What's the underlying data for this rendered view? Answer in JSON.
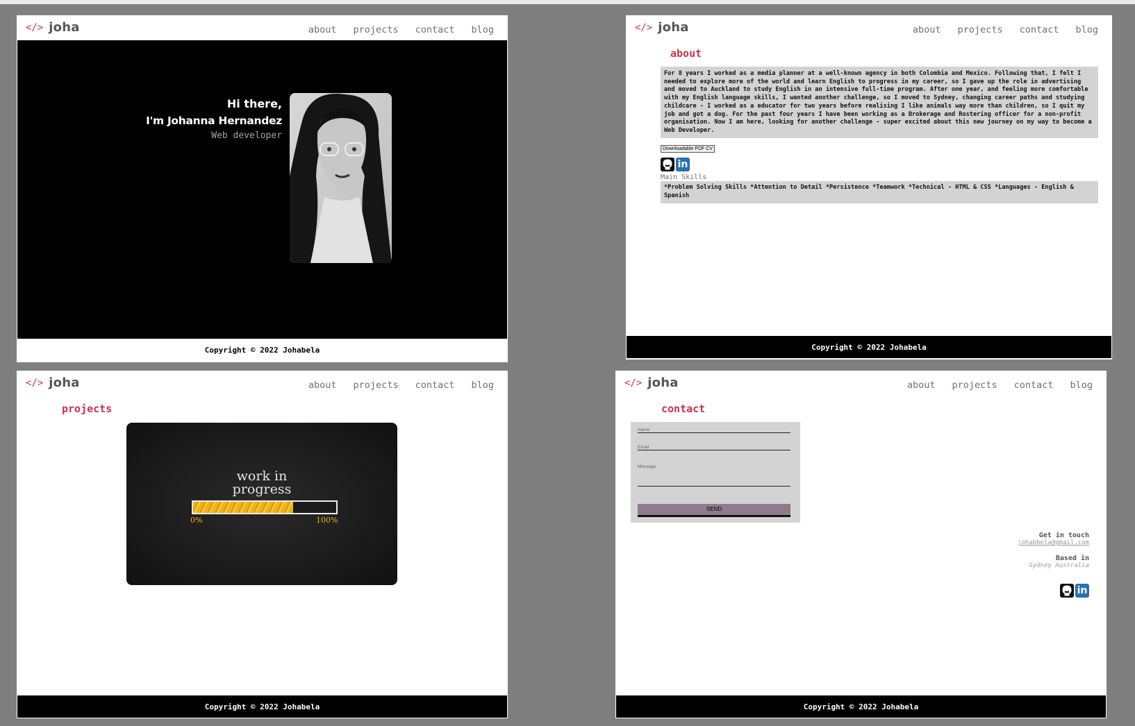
{
  "brand": {
    "mark": "</>",
    "name": "joha"
  },
  "nav": [
    "about",
    "projects",
    "contact",
    "blog"
  ],
  "footer": "Copyright © 2022 Johabela",
  "home": {
    "greeting": "Hi there,",
    "intro": "I'm Johanna Hernandez",
    "role": "Web developer"
  },
  "about": {
    "title": "about",
    "bio": "For 8 years I worked as a media planner at a well-known agency in both Colombia and Mexico. Following that, I felt I needed to explore more of the world and learn English to progress in my career, so I gave up the role in advertising and moved to Auckland to study English in an intensive full-time program. After one year, and feeling more comfortable with my English language skills, I wanted another challenge, so I moved to Sydney, changing career paths and studying childcare - I worked as a educator for two years before realising I like animals way more than children, so I quit my job and got a dog. For the past four years I have been working as a Brokerage and Rostering officer for a non-profit organisation. Now I am here, looking for another challenge - super excited about this new journey on my way to become a Web Developer.",
    "cv_button": "Downloadable PDF CV",
    "skills_label": "Main Skills",
    "skills": "*Problem Solving Skills *Attention to Detail *Persistence *Teamwork *Technical - HTML & CSS *Languages - English & Spanish"
  },
  "projects": {
    "title": "projects",
    "wip_line1": "work in",
    "wip_line2": "progress",
    "wip_start": "0%",
    "wip_end": "100%",
    "wip_progress": 0.7
  },
  "contact": {
    "title": "contact",
    "name_placeholder": "Name",
    "email_placeholder": "Email",
    "message_placeholder": "Message",
    "send": "SEND",
    "get_in_touch": "Get in touch",
    "email": "johabbela@gmail.com",
    "based_in": "Based in",
    "location": "Sydney Australia"
  },
  "icons": {
    "github": "github-icon",
    "linkedin": "linkedin-icon"
  },
  "colors": {
    "accent": "#c8324f",
    "nav": "#7a6a75",
    "muted_purple": "#b39cb0",
    "button": "#8e7b8c"
  }
}
